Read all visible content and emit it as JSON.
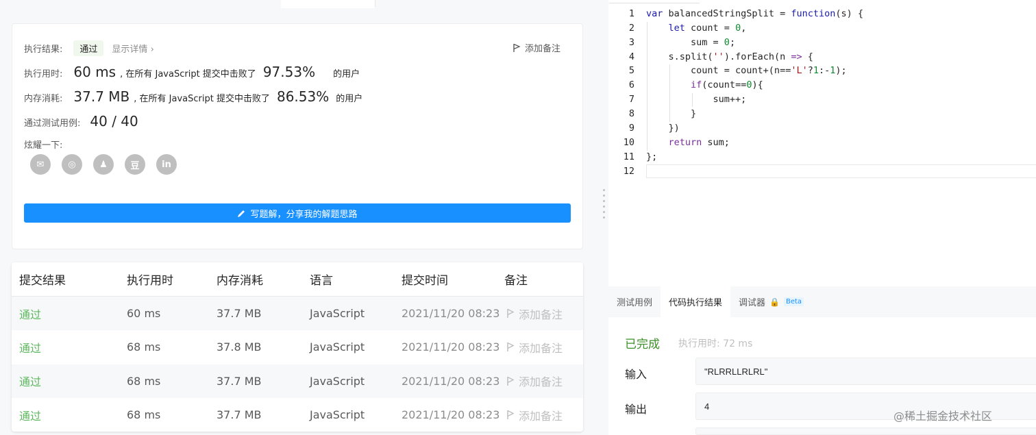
{
  "result": {
    "status_label": "执行结果:",
    "status_badge": "通过",
    "detail_link": "显示详情",
    "add_note": "添加备注",
    "runtime_label": "执行用时:",
    "runtime_value": "60 ms",
    "runtime_mid": ", 在所有 JavaScript 提交中击败了",
    "runtime_pct": "97.53%",
    "users_suffix": "的用户",
    "memory_label": "内存消耗:",
    "memory_value": "37.7 MB",
    "memory_mid": ", 在所有 JavaScript 提交中击败了",
    "memory_pct": "86.53%",
    "tests_label": "通过测试用例:",
    "tests_value": "40 / 40",
    "share_label": "炫耀一下:",
    "share_icons": [
      {
        "name": "wechat-icon",
        "glyph": "✉"
      },
      {
        "name": "weibo-icon",
        "glyph": "◎"
      },
      {
        "name": "qq-icon",
        "glyph": "♟"
      },
      {
        "name": "douban-icon",
        "glyph": "豆"
      },
      {
        "name": "linkedin-icon",
        "glyph": "in"
      }
    ],
    "solution_button": "写题解，分享我的解题思路"
  },
  "submissions": {
    "headers": [
      "提交结果",
      "执行用时",
      "内存消耗",
      "语言",
      "提交时间",
      "备注"
    ],
    "rows": [
      {
        "result": "通过",
        "time": "60 ms",
        "memory": "37.7 MB",
        "lang": "JavaScript",
        "submitted": "2021/11/20 08:23",
        "note": "添加备注"
      },
      {
        "result": "通过",
        "time": "68 ms",
        "memory": "37.8 MB",
        "lang": "JavaScript",
        "submitted": "2021/11/20 08:23",
        "note": "添加备注"
      },
      {
        "result": "通过",
        "time": "68 ms",
        "memory": "37.7 MB",
        "lang": "JavaScript",
        "submitted": "2021/11/20 08:23",
        "note": "添加备注"
      },
      {
        "result": "通过",
        "time": "68 ms",
        "memory": "37.7 MB",
        "lang": "JavaScript",
        "submitted": "2021/11/20 08:23",
        "note": "添加备注"
      }
    ]
  },
  "editor": {
    "line_numbers": [
      "1",
      "2",
      "3",
      "4",
      "5",
      "6",
      "7",
      "8",
      "9",
      "10",
      "11",
      "12"
    ]
  },
  "console": {
    "tabs": [
      "测试用例",
      "代码执行结果",
      "调试器"
    ],
    "beta": "Beta",
    "done": "已完成",
    "exec_time": "执行用时: 72 ms",
    "input_label": "输入",
    "input_value": "\"RLRRLLRLRL\"",
    "output_label": "输出",
    "output_value": "4"
  },
  "watermark": "@稀土掘金技术社区",
  "colors": {
    "accent": "#1890ff",
    "pass_green": "#5cb85c",
    "done_green": "#3c8f28"
  }
}
